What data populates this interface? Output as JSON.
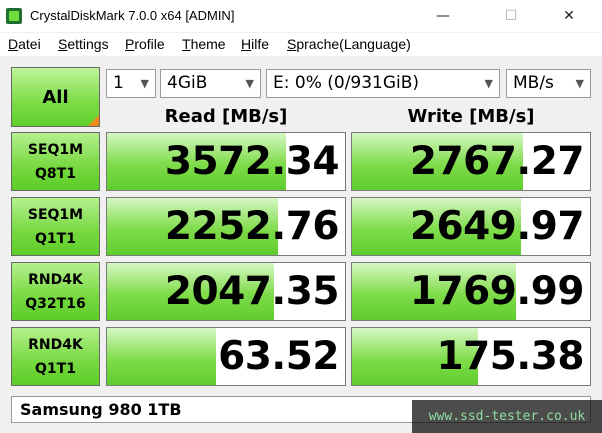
{
  "window": {
    "title": "CrystalDiskMark 7.0.0 x64 [ADMIN]",
    "minimize_glyph": "—",
    "maximize_glyph": "☐",
    "close_glyph": "✕"
  },
  "menu": [
    {
      "accel": "D",
      "rest": "atei"
    },
    {
      "accel": "S",
      "rest": "ettings"
    },
    {
      "accel": "P",
      "rest": "rofile"
    },
    {
      "accel": "T",
      "rest": "heme"
    },
    {
      "accel": "H",
      "rest": "ilfe"
    },
    {
      "accel": "S",
      "rest": "prache(Language)"
    }
  ],
  "controls": {
    "all_label": "All",
    "count": "1",
    "size": "4GiB",
    "drive": "E: 0% (0/931GiB)",
    "unit": "MB/s"
  },
  "headers": {
    "read": "Read [MB/s]",
    "write": "Write [MB/s]"
  },
  "tests": [
    {
      "line1": "SEQ1M",
      "line2": "Q8T1",
      "read": "3572.34",
      "write": "2767.27",
      "read_fill": 0.75,
      "write_fill": 0.72
    },
    {
      "line1": "SEQ1M",
      "line2": "Q1T1",
      "read": "2252.76",
      "write": "2649.97",
      "read_fill": 0.72,
      "write_fill": 0.71
    },
    {
      "line1": "RND4K",
      "line2": "Q32T16",
      "read": "2047.35",
      "write": "1769.99",
      "read_fill": 0.7,
      "write_fill": 0.69
    },
    {
      "line1": "RND4K",
      "line2": "Q1T1",
      "read": "63.52",
      "write": "175.38",
      "read_fill": 0.46,
      "write_fill": 0.53
    }
  ],
  "drive_name": "Samsung 980 1TB",
  "watermark": "www.ssd-tester.co.uk",
  "colors": {
    "green_accent": "#6fdd3b",
    "orange_corner": "#f08a1c"
  }
}
